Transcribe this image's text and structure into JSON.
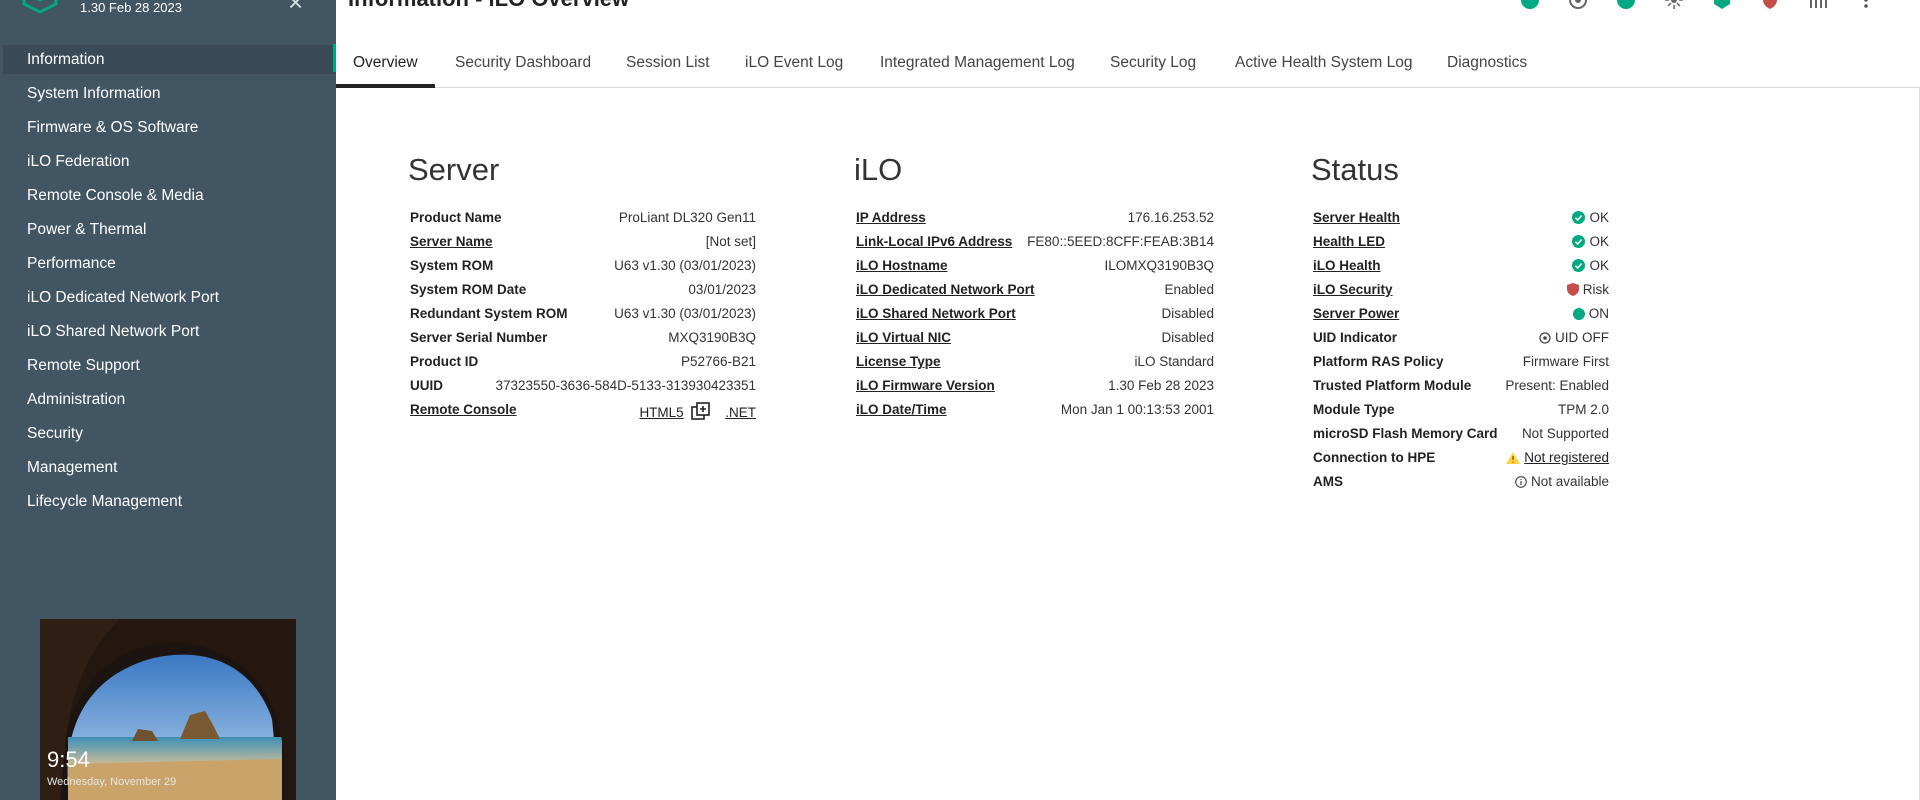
{
  "sidebar": {
    "fw_version": "1.30 Feb 28 2023",
    "items": [
      {
        "label": "Information"
      },
      {
        "label": "System Information"
      },
      {
        "label": "Firmware & OS Software"
      },
      {
        "label": "iLO Federation"
      },
      {
        "label": "Remote Console & Media"
      },
      {
        "label": "Power & Thermal"
      },
      {
        "label": "Performance"
      },
      {
        "label": "iLO Dedicated Network Port"
      },
      {
        "label": "iLO Shared Network Port"
      },
      {
        "label": "Remote Support"
      },
      {
        "label": "Administration"
      },
      {
        "label": "Security"
      },
      {
        "label": "Management"
      },
      {
        "label": "Lifecycle Management"
      }
    ],
    "thumbnail": {
      "time": "9:54",
      "date": "Wednesday, November 29"
    }
  },
  "header": {
    "title": "Information - iLO Overview",
    "icons": [
      "health-ok-icon",
      "settings-badge-icon",
      "status-ok-icon",
      "uid-icon",
      "language-icon",
      "security-shield-icon",
      "power-chart-icon",
      "more-options-icon"
    ]
  },
  "tabs": [
    {
      "label": "Overview"
    },
    {
      "label": "Security Dashboard"
    },
    {
      "label": "Session List"
    },
    {
      "label": "iLO Event Log"
    },
    {
      "label": "Integrated Management Log"
    },
    {
      "label": "Security Log"
    },
    {
      "label": "Active Health System Log"
    },
    {
      "label": "Diagnostics"
    }
  ],
  "server": {
    "heading": "Server",
    "rows": [
      {
        "label": "Product Name",
        "value": "ProLiant DL320 Gen11"
      },
      {
        "label": "Server Name",
        "value": "[Not set]"
      },
      {
        "label": "System ROM",
        "value": "U63 v1.30 (03/01/2023)"
      },
      {
        "label": "System ROM Date",
        "value": "03/01/2023"
      },
      {
        "label": "Redundant System ROM",
        "value": "U63 v1.30 (03/01/2023)"
      },
      {
        "label": "Server Serial Number",
        "value": "MXQ3190B3Q"
      },
      {
        "label": "Product ID",
        "value": "P52766-B21"
      },
      {
        "label": "UUID",
        "value": "37323550-3636-584D-5133-313930423351"
      },
      {
        "label": "Remote Console",
        "html5": "HTML5",
        "net": ".NET"
      }
    ]
  },
  "ilo": {
    "heading": "iLO",
    "rows": [
      {
        "label": "IP Address",
        "value": "176.16.253.52"
      },
      {
        "label": "Link-Local IPv6 Address",
        "value": "FE80::5EED:8CFF:FEAB:3B14"
      },
      {
        "label": "iLO Hostname",
        "value": "ILOMXQ3190B3Q"
      },
      {
        "label": "iLO Dedicated Network Port",
        "value": "Enabled"
      },
      {
        "label": "iLO Shared Network Port",
        "value": "Disabled"
      },
      {
        "label": "iLO Virtual NIC",
        "value": "Disabled"
      },
      {
        "label": "License Type",
        "value": "iLO Standard"
      },
      {
        "label": "iLO Firmware Version",
        "value": "1.30 Feb 28 2023"
      },
      {
        "label": "iLO Date/Time",
        "value": "Mon Jan 1 00:13:53 2001"
      }
    ]
  },
  "status": {
    "heading": "Status",
    "rows": [
      {
        "label": "Server Health",
        "value": "OK"
      },
      {
        "label": "Health LED",
        "value": "OK"
      },
      {
        "label": "iLO Health",
        "value": "OK"
      },
      {
        "label": "iLO Security",
        "value": "Risk"
      },
      {
        "label": "Server Power",
        "value": "ON"
      },
      {
        "label": "UID Indicator",
        "value": "UID OFF"
      },
      {
        "label": "Platform RAS Policy",
        "value": "Firmware First"
      },
      {
        "label": "Trusted Platform Module",
        "value": "Present: Enabled"
      },
      {
        "label": "Module Type",
        "value": "TPM 2.0"
      },
      {
        "label": "microSD Flash Memory Card",
        "value": "Not Supported"
      },
      {
        "label": "Connection to HPE",
        "value": "Not registered"
      },
      {
        "label": "AMS",
        "value": "Not available"
      }
    ]
  },
  "colors": {
    "sidebar_bg": "#425563",
    "accent": "#01a982",
    "ok_green": "#01a982",
    "risk_red": "#c54e4b",
    "warning_yellow": "#ffd144"
  }
}
